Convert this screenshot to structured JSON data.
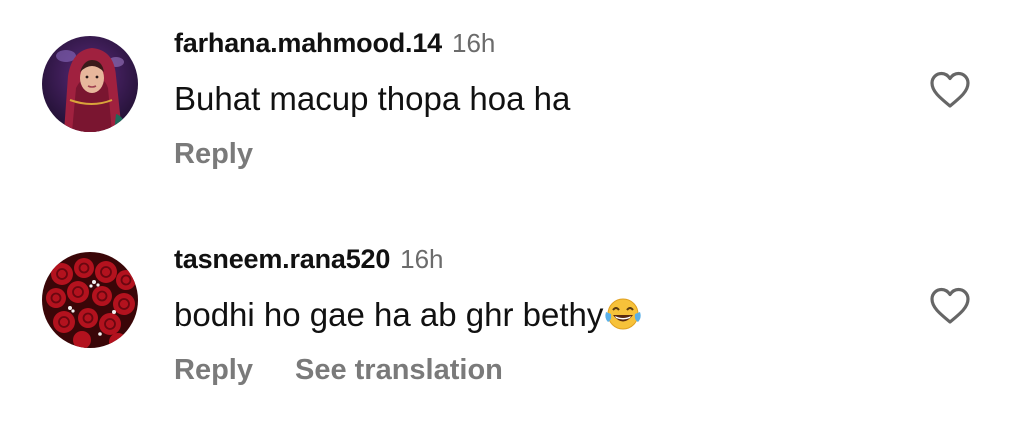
{
  "comments": [
    {
      "username": "farhana.mahmood.14",
      "timestamp": "16h",
      "text": "Buhat macup thopa hoa ha",
      "actions": {
        "reply": "Reply"
      },
      "avatar_icon": "profile-photo-woman-red-dupatta"
    },
    {
      "username": "tasneem.rana520",
      "timestamp": "16h",
      "text": "bodhi ho gae ha ab ghr bethy",
      "text_emoji": "face-with-tears-of-joy",
      "actions": {
        "reply": "Reply",
        "translate": "See translation"
      },
      "avatar_icon": "profile-photo-red-roses"
    }
  ],
  "like_icon": "heart-outline-icon",
  "colors": {
    "username": "#111111",
    "timestamp": "#6b6b6b",
    "action": "#7a7a7a",
    "background": "#ffffff"
  }
}
